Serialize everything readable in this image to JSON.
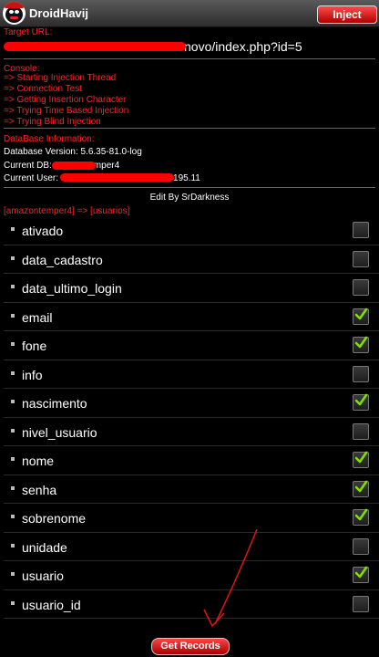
{
  "app": {
    "title": "DroidHavij",
    "inject_label": "Inject"
  },
  "target": {
    "label": "Target URL:",
    "url_suffix": "novo/index.php?id=5"
  },
  "console": {
    "label": "Console:",
    "lines": [
      "=> Starting Injection Thread",
      "=> Connection Test",
      "=> Getting Insertion Character",
      "=> Trying Time Based Injection",
      "=> Trying Blind Injection"
    ]
  },
  "database": {
    "label": "DataBase Information:",
    "version": "Database Version: 5.6.35-81.0-log",
    "current_db_prefix": "Current DB:",
    "current_db_visible": "mper4",
    "current_user_prefix": "Current User:",
    "current_user_visible": "195.11"
  },
  "edit_by": "Edit By SrDarkness",
  "table_path": "[amazontemper4] => [usuarios]",
  "columns": [
    {
      "name": "ativado",
      "checked": false
    },
    {
      "name": "data_cadastro",
      "checked": false
    },
    {
      "name": "data_ultimo_login",
      "checked": false
    },
    {
      "name": "email",
      "checked": true
    },
    {
      "name": "fone",
      "checked": true
    },
    {
      "name": "info",
      "checked": false
    },
    {
      "name": "nascimento",
      "checked": true
    },
    {
      "name": "nivel_usuario",
      "checked": false
    },
    {
      "name": "nome",
      "checked": true
    },
    {
      "name": "senha",
      "checked": true
    },
    {
      "name": "sobrenome",
      "checked": true
    },
    {
      "name": "unidade",
      "checked": false
    },
    {
      "name": "usuario",
      "checked": true
    },
    {
      "name": "usuario_id",
      "checked": false
    }
  ],
  "get_records_label": "Get Records",
  "colors": {
    "accent_red": "#ff2222",
    "check_green": "#7fe000"
  }
}
